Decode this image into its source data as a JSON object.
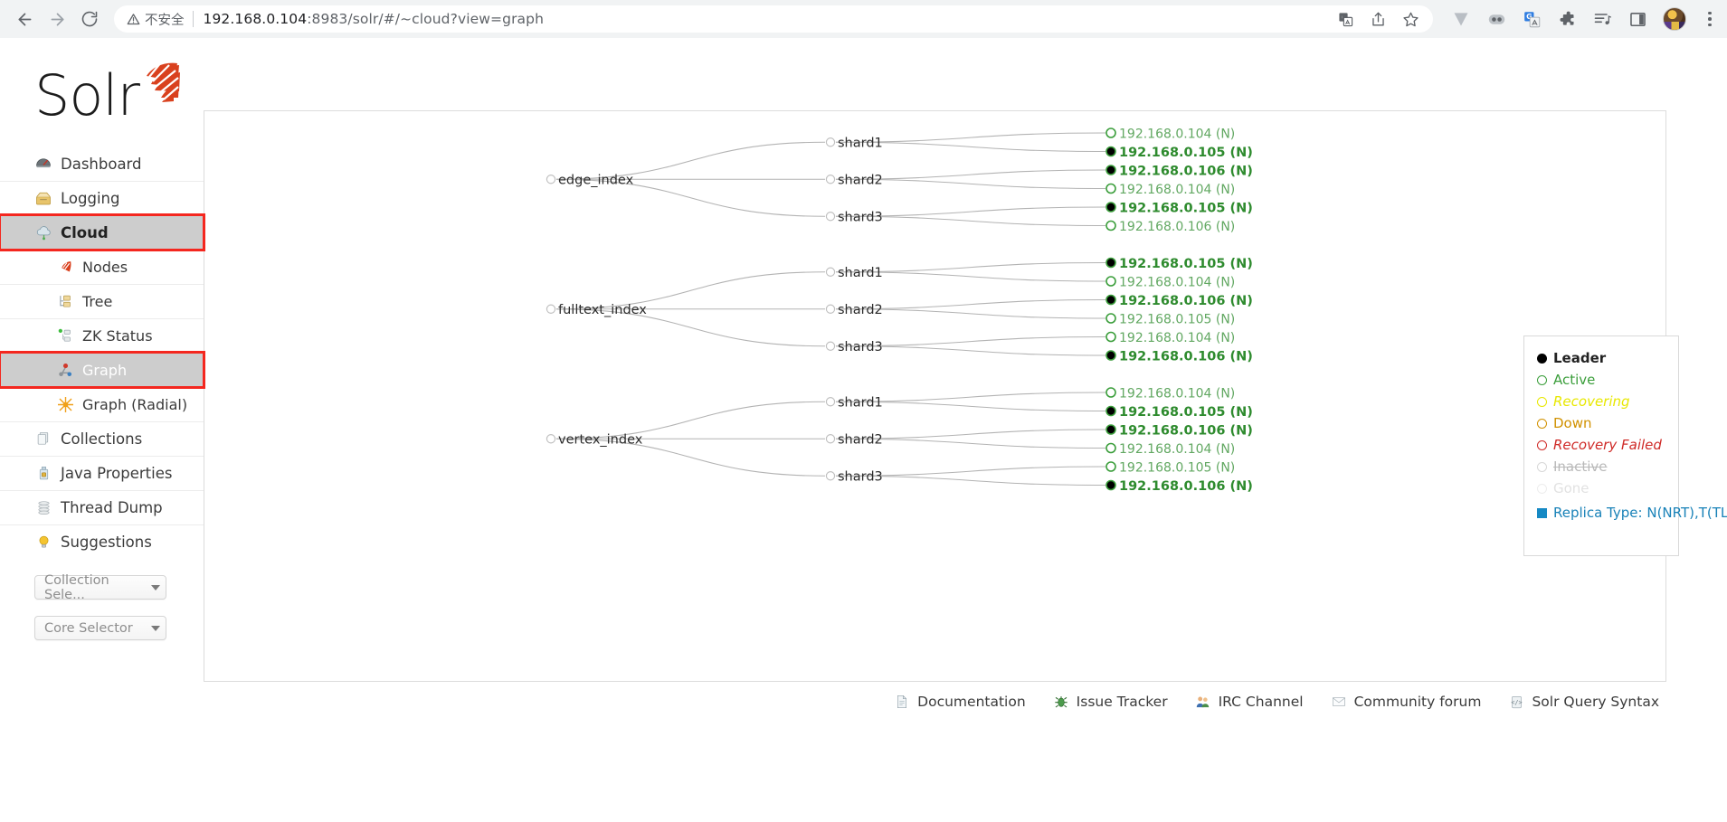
{
  "browser": {
    "back_icon": "back-arrow-icon",
    "forward_icon": "forward-arrow-icon",
    "reload_icon": "reload-icon",
    "security_label": "不安全",
    "url_host": "192.168.0.104",
    "url_rest": ":8983/solr/#/~cloud?view=graph",
    "omnibox_icons": [
      "translate-icon",
      "share-icon",
      "bookmark-star-icon"
    ],
    "extension_icons": [
      "vimium-icon",
      "extension-toolbar-icon",
      "google-translate-icon",
      "puzzle-extensions-icon",
      "playlist-icon",
      "reading-list-icon"
    ],
    "profile_icon": "profile-avatar",
    "menu_icon": "chrome-menu-icon"
  },
  "sidebar": {
    "logo_text": "Solr",
    "items": [
      {
        "label": "Dashboard",
        "icon": "dashboard-icon",
        "level": "top",
        "state": "normal"
      },
      {
        "label": "Logging",
        "icon": "logging-icon",
        "level": "top",
        "state": "normal"
      },
      {
        "label": "Cloud",
        "icon": "cloud-icon",
        "level": "top",
        "state": "active-parent"
      },
      {
        "label": "Nodes",
        "icon": "nodes-icon",
        "level": "sub",
        "state": "normal"
      },
      {
        "label": "Tree",
        "icon": "tree-icon",
        "level": "sub",
        "state": "normal"
      },
      {
        "label": "ZK Status",
        "icon": "zk-status-icon",
        "level": "sub",
        "state": "normal"
      },
      {
        "label": "Graph",
        "icon": "graph-icon",
        "level": "sub",
        "state": "active-child"
      },
      {
        "label": "Graph (Radial)",
        "icon": "graph-radial-icon",
        "level": "sub",
        "state": "normal"
      },
      {
        "label": "Collections",
        "icon": "collections-icon",
        "level": "top",
        "state": "normal"
      },
      {
        "label": "Java Properties",
        "icon": "java-properties-icon",
        "level": "top",
        "state": "normal"
      },
      {
        "label": "Thread Dump",
        "icon": "thread-dump-icon",
        "level": "top",
        "state": "normal"
      },
      {
        "label": "Suggestions",
        "icon": "suggestions-icon",
        "level": "top",
        "state": "normal"
      }
    ],
    "collection_selector": "Collection Sele...",
    "core_selector": "Core Selector"
  },
  "graph": {
    "collections": [
      {
        "name": "edge_index",
        "shards": [
          {
            "name": "shard1",
            "replicas": [
              {
                "host": "192.168.0.104 (N)",
                "leader": false
              },
              {
                "host": "192.168.0.105 (N)",
                "leader": true
              }
            ]
          },
          {
            "name": "shard2",
            "replicas": [
              {
                "host": "192.168.0.106 (N)",
                "leader": true
              },
              {
                "host": "192.168.0.104 (N)",
                "leader": false
              }
            ]
          },
          {
            "name": "shard3",
            "replicas": [
              {
                "host": "192.168.0.105 (N)",
                "leader": true
              },
              {
                "host": "192.168.0.106 (N)",
                "leader": false
              }
            ]
          }
        ]
      },
      {
        "name": "fulltext_index",
        "shards": [
          {
            "name": "shard1",
            "replicas": [
              {
                "host": "192.168.0.105 (N)",
                "leader": true
              },
              {
                "host": "192.168.0.104 (N)",
                "leader": false
              }
            ]
          },
          {
            "name": "shard2",
            "replicas": [
              {
                "host": "192.168.0.106 (N)",
                "leader": true
              },
              {
                "host": "192.168.0.105 (N)",
                "leader": false
              }
            ]
          },
          {
            "name": "shard3",
            "replicas": [
              {
                "host": "192.168.0.104 (N)",
                "leader": false
              },
              {
                "host": "192.168.0.106 (N)",
                "leader": true
              }
            ]
          }
        ]
      },
      {
        "name": "vertex_index",
        "shards": [
          {
            "name": "shard1",
            "replicas": [
              {
                "host": "192.168.0.104 (N)",
                "leader": false
              },
              {
                "host": "192.168.0.105 (N)",
                "leader": true
              }
            ]
          },
          {
            "name": "shard2",
            "replicas": [
              {
                "host": "192.168.0.106 (N)",
                "leader": true
              },
              {
                "host": "192.168.0.104 (N)",
                "leader": false
              }
            ]
          },
          {
            "name": "shard3",
            "replicas": [
              {
                "host": "192.168.0.105 (N)",
                "leader": false
              },
              {
                "host": "192.168.0.106 (N)",
                "leader": true
              }
            ]
          }
        ]
      }
    ],
    "colors": {
      "leader": "#000000",
      "active": "#3b9e3b",
      "active_text": "#62a862",
      "leader_text": "#2e8b2e",
      "link": "#b3b3b3",
      "node_ring": "#c0c0c0"
    }
  },
  "legend": {
    "title_rows": [
      {
        "label": "Leader",
        "key": "leader"
      },
      {
        "label": "Active",
        "key": "active"
      },
      {
        "label": "Recovering",
        "key": "recovering"
      },
      {
        "label": "Down",
        "key": "down"
      },
      {
        "label": "Recovery Failed",
        "key": "failed"
      },
      {
        "label": "Inactive",
        "key": "inactive"
      },
      {
        "label": "Gone",
        "key": "gone"
      }
    ],
    "replica_type_label": "Replica Type:",
    "replica_type_value": "N(NRT),T(TLOG), P(PULL)"
  },
  "footer": {
    "links": [
      {
        "label": "Documentation",
        "icon": "document-icon"
      },
      {
        "label": "Issue Tracker",
        "icon": "bug-icon"
      },
      {
        "label": "IRC Channel",
        "icon": "people-icon"
      },
      {
        "label": "Community forum",
        "icon": "envelope-icon"
      },
      {
        "label": "Solr Query Syntax",
        "icon": "code-icon"
      }
    ]
  }
}
